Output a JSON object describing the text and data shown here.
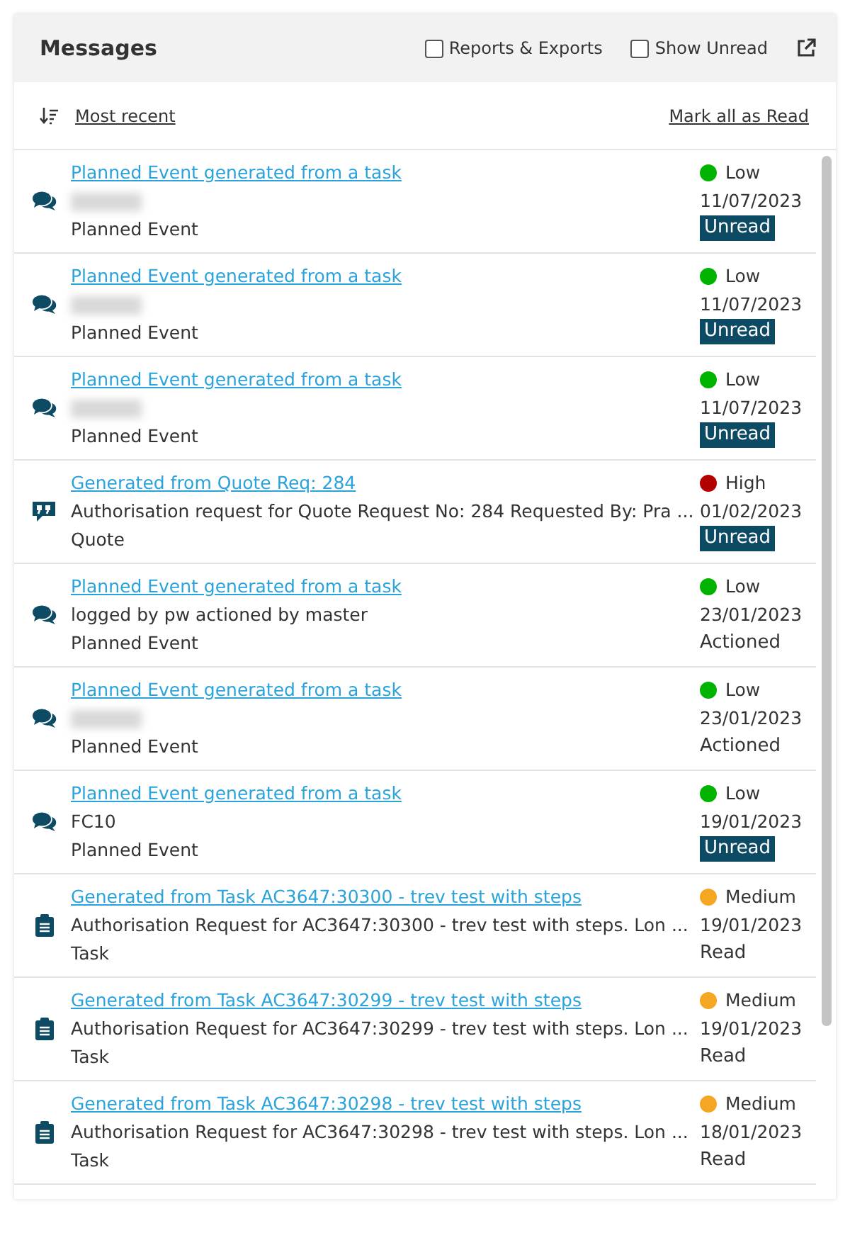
{
  "header": {
    "title": "Messages",
    "checkboxes": [
      {
        "label": "Reports & Exports",
        "checked": false
      },
      {
        "label": "Show Unread",
        "checked": false
      }
    ]
  },
  "toolbar": {
    "sort_label": "Most recent",
    "mark_all": "Mark all as Read"
  },
  "messages": [
    {
      "kind": "chat",
      "title": "Planned Event generated from a task",
      "redacted": true,
      "type": "Planned Event",
      "priority": "Low",
      "color": "#00b300",
      "date": "11/07/2023",
      "status": "Unread",
      "highlighted": true
    },
    {
      "kind": "chat",
      "title": "Planned Event generated from a task",
      "redacted": true,
      "type": "Planned Event",
      "priority": "Low",
      "color": "#00b300",
      "date": "11/07/2023",
      "status": "Unread",
      "highlighted": true
    },
    {
      "kind": "chat",
      "title": "Planned Event generated from a task",
      "redacted": true,
      "type": "Planned Event",
      "priority": "Low",
      "color": "#00b300",
      "date": "11/07/2023",
      "status": "Unread",
      "highlighted": true
    },
    {
      "kind": "quote",
      "title": "Generated from Quote Req: 284",
      "body": "Authorisation request for Quote Request No: 284 Requested By: Pra ...",
      "type": "Quote",
      "priority": "High",
      "color": "#b30000",
      "date": "01/02/2023",
      "status": "Unread",
      "highlighted": true
    },
    {
      "kind": "chat",
      "title": "Planned Event generated from a task",
      "body": "logged by pw actioned by master",
      "type": "Planned Event",
      "priority": "Low",
      "color": "#00b300",
      "date": "23/01/2023",
      "status": "Actioned",
      "highlighted": false
    },
    {
      "kind": "chat",
      "title": "Planned Event generated from a task",
      "redacted": true,
      "type": "Planned Event",
      "priority": "Low",
      "color": "#00b300",
      "date": "23/01/2023",
      "status": "Actioned",
      "highlighted": false
    },
    {
      "kind": "chat",
      "title": "Planned Event generated from a task",
      "body": "FC10",
      "type": "Planned Event",
      "priority": "Low",
      "color": "#00b300",
      "date": "19/01/2023",
      "status": "Unread",
      "highlighted": true
    },
    {
      "kind": "task",
      "title": "Generated from Task AC3647:30300 - trev test with steps",
      "body": "Authorisation Request for AC3647:30300 - trev test with steps. Lon ...",
      "type": "Task",
      "priority": "Medium",
      "color": "#f5a623",
      "date": "19/01/2023",
      "status": "Read",
      "highlighted": false
    },
    {
      "kind": "task",
      "title": "Generated from Task AC3647:30299 - trev test with steps",
      "body": "Authorisation Request for AC3647:30299 - trev test with steps. Lon ...",
      "type": "Task",
      "priority": "Medium",
      "color": "#f5a623",
      "date": "19/01/2023",
      "status": "Read",
      "highlighted": false
    },
    {
      "kind": "task",
      "title": "Generated from Task AC3647:30298 - trev test with steps",
      "body": "Authorisation Request for AC3647:30298 - trev test with steps. Lon ...",
      "type": "Task",
      "priority": "Medium",
      "color": "#f5a623",
      "date": "18/01/2023",
      "status": "Read",
      "highlighted": false
    }
  ]
}
